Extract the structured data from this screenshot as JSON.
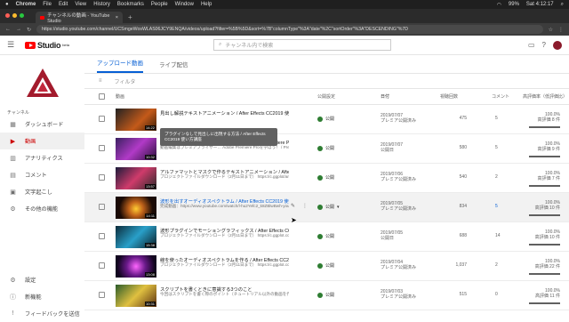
{
  "macos": {
    "app": "Chrome",
    "menus": [
      "File",
      "Edit",
      "View",
      "History",
      "Bookmarks",
      "People",
      "Window",
      "Help"
    ],
    "battery": "99%",
    "clock": "Sat 4:12:17"
  },
  "browser": {
    "tab_title": "チャンネルの動画 - YouTube Studio",
    "url": "https://studio.youtube.com/channel/UCSmgeWosWLAS06JCY9ENQA/videos/upload?filter=%5B%5D&sort=%7B\"columnType\"%3A\"date\"%2C\"sortOrder\"%3A\"DESCENDING\"%7D"
  },
  "header": {
    "logo_text": "Studio",
    "logo_badge": "beta",
    "search_placeholder": "チャンネル内で検索"
  },
  "sidebar": {
    "channel_label": "チャンネル",
    "items": [
      {
        "label": "ダッシュボード",
        "icon": "dashboard-icon"
      },
      {
        "label": "動画",
        "icon": "video-icon",
        "active": true
      },
      {
        "label": "アナリティクス",
        "icon": "analytics-icon"
      },
      {
        "label": "コメント",
        "icon": "comment-icon"
      },
      {
        "label": "文字起こし",
        "icon": "subtitles-icon"
      },
      {
        "label": "その他の機能",
        "icon": "more-features-icon"
      }
    ],
    "bottom_items": [
      {
        "label": "設定",
        "icon": "gear-icon"
      },
      {
        "label": "新機能",
        "icon": "info-icon"
      },
      {
        "label": "フィードバックを送信",
        "icon": "feedback-icon"
      }
    ]
  },
  "main": {
    "tabs": [
      "アップロード動画",
      "ライブ配信"
    ],
    "filter_label": "フィルタ",
    "columns": {
      "video": "動画",
      "visibility": "公開設定",
      "date": "日付",
      "views": "視聴回数",
      "comments": "コメント",
      "likes": "高評価率（低評価比）"
    },
    "tooltip": "プラグインなしで見出しに出現する方法 / After Effects CC2019 使い方講座",
    "rows": [
      {
        "title": "見出し解説テキストアニメーション / After Effects CC2019 使い方講座",
        "desc": "",
        "duration": "14:22",
        "visibility": "公開",
        "date": "2019/07/07",
        "status": "プレミア公開済み",
        "views": "475",
        "comments": "5",
        "likes": "100.0%",
        "likes_sub": "高評価 8 件"
      },
      {
        "title": "Premiere Proの音声をAdobe Auditionで補正する / Premiere Pr...",
        "desc": "動画編集はプレミアプライザー… Adobe Premiere Proを学ぼう！ / Premiere Pro 動画 https://www.udemy.com/course/premierepro",
        "duration": "10:32",
        "visibility": "公開",
        "date": "2019/07/07",
        "status": "公開日",
        "views": "580",
        "comments": "5",
        "likes": "100.0%",
        "likes_sub": "高評価 9 件"
      },
      {
        "title": "アルファマットとマスクで作るテキストアニメーション / After Effe...",
        "desc": "プロジェクトファイルダウンロード（2月11日まで） https://c.ggplot/ar.co/3534-after.. ファイルダウンロード",
        "duration": "13:57",
        "visibility": "公開",
        "date": "2019/07/06",
        "status": "プレミア公開済み",
        "views": "540",
        "comments": "2",
        "likes": "100.0%",
        "likes_sub": "高評価 7 件"
      },
      {
        "title": "波形を出すオーディオスペクトラム / After Effects CC2019 使...",
        "desc": "完成動画：https://www.youtube.com/watch/l-hu2Yefc2_k8ZBlwBwh-youtu.be ファイル",
        "duration": "14:11",
        "visibility": "公開",
        "date": "2019/07/05",
        "status": "プレミア公開済み",
        "views": "834",
        "comments": "5",
        "likes": "100.0%",
        "likes_sub": "高評価 10 件"
      },
      {
        "title": "波形プラグインでモーショングラフィックス / After Effects CC2019...",
        "desc": "プロジェクトファイルダウンロード（2月11日まで） https://c.ggplot.co/l804-after.. ファイルダウンロード",
        "duration": "15:38",
        "visibility": "公開",
        "date": "2019/07/05",
        "status": "公開日",
        "views": "688",
        "comments": "14",
        "likes": "100.0%",
        "likes_sub": "高評価 10 件"
      },
      {
        "title": "線を使ったオーディオスペクトラムを作る / After Effects CC201...",
        "desc": "プロジェクトファイルダウンロード（2月11日まで） https://c.ggplot.co/n8g8-afte.. ファイルダウンロード",
        "duration": "13:08",
        "visibility": "公開",
        "date": "2019/07/04",
        "status": "プレミア公開済み",
        "views": "1,037",
        "comments": "2",
        "likes": "100.0%",
        "likes_sub": "高評価 22 件"
      },
      {
        "title": "スクリプトを書くときに意識する3つのこと",
        "desc": "今回はスクリプトを書く際のポイント（チュートリアル以外の動画を作ったりするときのコツ）【問題動画】 スクリプトの書き方",
        "duration": "10:31",
        "visibility": "公開",
        "date": "2019/07/03",
        "status": "プレミア公開済み",
        "views": "515",
        "comments": "0",
        "likes": "100.0%",
        "likes_sub": "高評価 11 件"
      }
    ]
  },
  "colors": {
    "accent": "#065fd4",
    "brand_red": "#ff0000",
    "public_green": "#2e7d32"
  }
}
